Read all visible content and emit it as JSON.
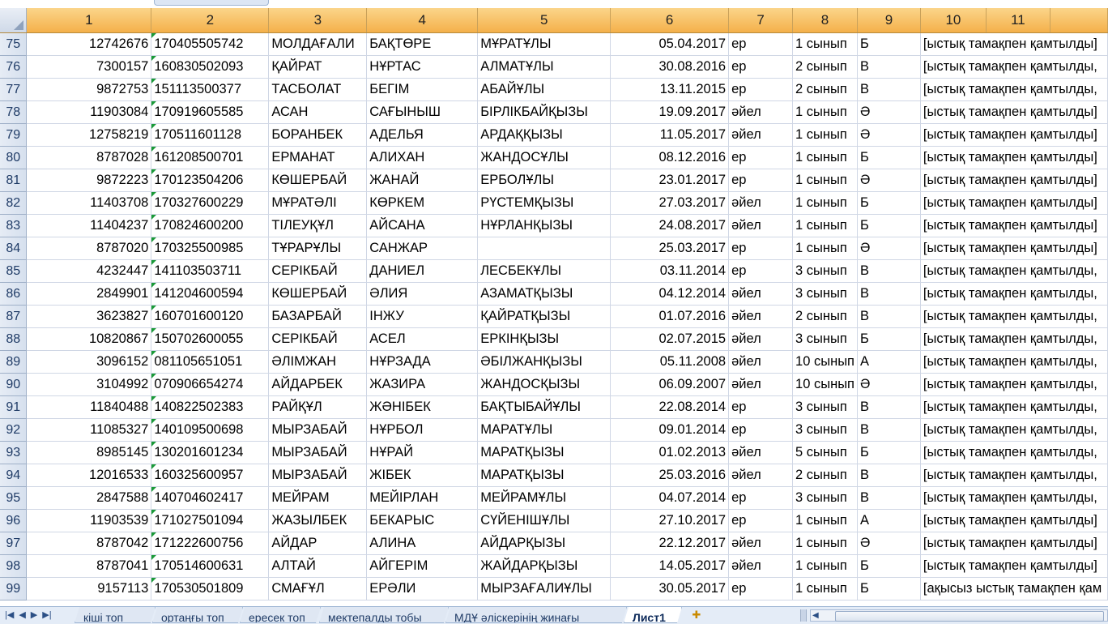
{
  "columns": [
    "1",
    "2",
    "3",
    "4",
    "5",
    "6",
    "7",
    "8",
    "9",
    "10",
    "11",
    ""
  ],
  "rows": [
    {
      "r": "75",
      "c1": "12742676",
      "c2": "170405505742",
      "c3": "МОЛДАҒАЛИ",
      "c4": "БАҚТӨРЕ",
      "c5": "МҰРАТҰЛЫ",
      "c6": "05.04.2017",
      "c7": "ер",
      "c8": "1 сынып",
      "c9": "Б",
      "c10": "[ыстық тамақпен қамтылды]"
    },
    {
      "r": "76",
      "c1": "7300157",
      "c2": "160830502093",
      "c3": "ҚАЙРАТ",
      "c4": "НҰРТАС",
      "c5": "АЛМАТҰЛЫ",
      "c6": "30.08.2016",
      "c7": "ер",
      "c8": "2 сынып",
      "c9": "В",
      "c10": "[ыстық тамақпен қамтылды,"
    },
    {
      "r": "77",
      "c1": "9872753",
      "c2": "151113500377",
      "c3": "ТАСБОЛАТ",
      "c4": "БЕГІМ",
      "c5": "АБАЙҰЛЫ",
      "c6": "13.11.2015",
      "c7": "ер",
      "c8": "2 сынып",
      "c9": "В",
      "c10": "[ыстық тамақпен қамтылды,"
    },
    {
      "r": "78",
      "c1": "11903084",
      "c2": "170919605585",
      "c3": "АСАН",
      "c4": "САҒЫНЫШ",
      "c5": "БІРЛІКБАЙҚЫЗЫ",
      "c6": "19.09.2017",
      "c7": "әйел",
      "c8": "1 сынып",
      "c9": "Ә",
      "c10": "[ыстық тамақпен қамтылды]"
    },
    {
      "r": "79",
      "c1": "12758219",
      "c2": "170511601128",
      "c3": "БОРАНБЕК",
      "c4": "АДЕЛЬЯ",
      "c5": "АРДАҚҚЫЗЫ",
      "c6": "11.05.2017",
      "c7": "әйел",
      "c8": "1 сынып",
      "c9": "Ә",
      "c10": "[ыстық тамақпен қамтылды]"
    },
    {
      "r": "80",
      "c1": "8787028",
      "c2": "161208500701",
      "c3": "ЕРМАНАТ",
      "c4": "АЛИХАН",
      "c5": "ЖАНДОСҰЛЫ",
      "c6": "08.12.2016",
      "c7": "ер",
      "c8": "1 сынып",
      "c9": "Б",
      "c10": "[ыстық тамақпен қамтылды]"
    },
    {
      "r": "81",
      "c1": "9872223",
      "c2": "170123504206",
      "c3": "КӨШЕРБАЙ",
      "c4": "ЖАНАЙ",
      "c5": "ЕРБОЛҰЛЫ",
      "c6": "23.01.2017",
      "c7": "ер",
      "c8": "1 сынып",
      "c9": "Ә",
      "c10": "[ыстық тамақпен қамтылды]"
    },
    {
      "r": "82",
      "c1": "11403708",
      "c2": "170327600229",
      "c3": "МҰРАТӘЛІ",
      "c4": "КӨРКЕМ",
      "c5": "РҮСТЕМҚЫЗЫ",
      "c6": "27.03.2017",
      "c7": "әйел",
      "c8": "1 сынып",
      "c9": "Б",
      "c10": "[ыстық тамақпен қамтылды]"
    },
    {
      "r": "83",
      "c1": "11404237",
      "c2": "170824600200",
      "c3": "ТІЛЕУҚҰЛ",
      "c4": "АЙСАНА",
      "c5": "НҰРЛАНҚЫЗЫ",
      "c6": "24.08.2017",
      "c7": "әйел",
      "c8": "1 сынып",
      "c9": "Б",
      "c10": "[ыстық тамақпен қамтылды]"
    },
    {
      "r": "84",
      "c1": "8787020",
      "c2": "170325500985",
      "c3": "ТҰРАРҰЛЫ",
      "c4": "САНЖАР",
      "c5": "",
      "c6": "25.03.2017",
      "c7": "ер",
      "c8": "1 сынып",
      "c9": "Ә",
      "c10": "[ыстық тамақпен қамтылды]"
    },
    {
      "r": "85",
      "c1": "4232447",
      "c2": "141103503711",
      "c3": "СЕРІКБАЙ",
      "c4": "ДАНИЕЛ",
      "c5": "ЛЕСБЕКҰЛЫ",
      "c6": "03.11.2014",
      "c7": "ер",
      "c8": "3 сынып",
      "c9": "В",
      "c10": "[ыстық тамақпен қамтылды,"
    },
    {
      "r": "86",
      "c1": "2849901",
      "c2": "141204600594",
      "c3": "КӨШЕРБАЙ",
      "c4": "ӘЛИЯ",
      "c5": "АЗАМАТҚЫЗЫ",
      "c6": "04.12.2014",
      "c7": "әйел",
      "c8": "3 сынып",
      "c9": "В",
      "c10": "[ыстық тамақпен қамтылды,"
    },
    {
      "r": "87",
      "c1": "3623827",
      "c2": "160701600120",
      "c3": "БАЗАРБАЙ",
      "c4": "ІНЖУ",
      "c5": "ҚАЙРАТҚЫЗЫ",
      "c6": "01.07.2016",
      "c7": "әйел",
      "c8": "2 сынып",
      "c9": "В",
      "c10": "[ыстық тамақпен қамтылды,"
    },
    {
      "r": "88",
      "c1": "10820867",
      "c2": "150702600055",
      "c3": "СЕРІКБАЙ",
      "c4": "АСЕЛ",
      "c5": "ЕРКІНҚЫЗЫ",
      "c6": "02.07.2015",
      "c7": "әйел",
      "c8": "3 сынып",
      "c9": "Б",
      "c10": "[ыстық тамақпен қамтылды,"
    },
    {
      "r": "89",
      "c1": "3096152",
      "c2": "081105651051",
      "c3": "ӘЛІМЖАН",
      "c4": "НҰРЗАДА",
      "c5": "ӘБІЛЖАНҚЫЗЫ",
      "c6": "05.11.2008",
      "c7": "әйел",
      "c8": "10 сынып",
      "c9": "А",
      "c10": "[ыстық тамақпен қамтылды,"
    },
    {
      "r": "90",
      "c1": "3104992",
      "c2": "070906654274",
      "c3": "АЙДАРБЕК",
      "c4": "ЖАЗИРА",
      "c5": "ЖАНДОСҚЫЗЫ",
      "c6": "06.09.2007",
      "c7": "әйел",
      "c8": "10 сынып",
      "c9": "Ә",
      "c10": "[ыстық тамақпен қамтылды,"
    },
    {
      "r": "91",
      "c1": "11840488",
      "c2": "140822502383",
      "c3": "РАЙҚҰЛ",
      "c4": "ЖӘНІБЕК",
      "c5": "БАҚТЫБАЙҰЛЫ",
      "c6": "22.08.2014",
      "c7": "ер",
      "c8": "3 сынып",
      "c9": "В",
      "c10": "[ыстық тамақпен қамтылды,"
    },
    {
      "r": "92",
      "c1": "11085327",
      "c2": "140109500698",
      "c3": "МЫРЗАБАЙ",
      "c4": "НҰРБОЛ",
      "c5": "МАРАТҰЛЫ",
      "c6": "09.01.2014",
      "c7": "ер",
      "c8": "3 сынып",
      "c9": "В",
      "c10": "[ыстық тамақпен қамтылды,"
    },
    {
      "r": "93",
      "c1": "8985145",
      "c2": "130201601234",
      "c3": "МЫРЗАБАЙ",
      "c4": "НҰРАЙ",
      "c5": "МАРАТҚЫЗЫ",
      "c6": "01.02.2013",
      "c7": "әйел",
      "c8": "5 сынып",
      "c9": "Б",
      "c10": "[ыстық тамақпен қамтылды,"
    },
    {
      "r": "94",
      "c1": "12016533",
      "c2": "160325600957",
      "c3": "МЫРЗАБАЙ",
      "c4": "ЖІБЕК",
      "c5": "МАРАТҚЫЗЫ",
      "c6": "25.03.2016",
      "c7": "әйел",
      "c8": "2 сынып",
      "c9": "В",
      "c10": "[ыстық тамақпен қамтылды,"
    },
    {
      "r": "95",
      "c1": "2847588",
      "c2": "140704602417",
      "c3": "МЕЙРАМ",
      "c4": "МЕЙІРЛАН",
      "c5": "МЕЙРАМҰЛЫ",
      "c6": "04.07.2014",
      "c7": "ер",
      "c8": "3 сынып",
      "c9": "В",
      "c10": "[ыстық тамақпен қамтылды,"
    },
    {
      "r": "96",
      "c1": "11903539",
      "c2": "171027501094",
      "c3": "ЖАЗЫЛБЕК",
      "c4": "БЕКАРЫС",
      "c5": "СҮЙЕНІШҰЛЫ",
      "c6": "27.10.2017",
      "c7": "ер",
      "c8": "1 сынып",
      "c9": "А",
      "c10": "[ыстық тамақпен қамтылды]"
    },
    {
      "r": "97",
      "c1": "8787042",
      "c2": "171222600756",
      "c3": "АЙДАР",
      "c4": "АЛИНА",
      "c5": "АЙДАРҚЫЗЫ",
      "c6": "22.12.2017",
      "c7": "әйел",
      "c8": "1 сынып",
      "c9": "Ә",
      "c10": "[ыстық тамақпен қамтылды]"
    },
    {
      "r": "98",
      "c1": "8787041",
      "c2": "170514600631",
      "c3": "АЛТАЙ",
      "c4": "АЙГЕРІМ",
      "c5": "ЖАЙДАРҚЫЗЫ",
      "c6": "14.05.2017",
      "c7": "әйел",
      "c8": "1 сынып",
      "c9": "Б",
      "c10": "[ыстық тамақпен қамтылды]"
    },
    {
      "r": "99",
      "c1": "9157113",
      "c2": "170530501809",
      "c3": "СМАҒҰЛ",
      "c4": "ЕРӘЛИ",
      "c5": "МЫРЗАҒАЛИҰЛЫ",
      "c6": "30.05.2017",
      "c7": "ер",
      "c8": "1 сынып",
      "c9": "Б",
      "c10": "[ақысыз ыстық тамақпен қам"
    }
  ],
  "sheet_tabs": [
    {
      "label": "кіші топ",
      "active": false
    },
    {
      "label": "ортаңғы топ",
      "active": false
    },
    {
      "label": "ересек топ",
      "active": false
    },
    {
      "label": "мектепалды тобы",
      "active": false
    },
    {
      "label": "МДҰ әліскерінің жинағы",
      "active": false
    },
    {
      "label": "Лист1",
      "active": true
    }
  ],
  "nav_icons": [
    "first-sheet-icon",
    "prev-sheet-icon",
    "next-sheet-icon",
    "last-sheet-icon"
  ],
  "colors": {
    "header_orange": "#f4b04a",
    "grid": "#d0d7e5",
    "iin_marker": "#1a9a38",
    "tabbar": "#e4ecf7"
  }
}
